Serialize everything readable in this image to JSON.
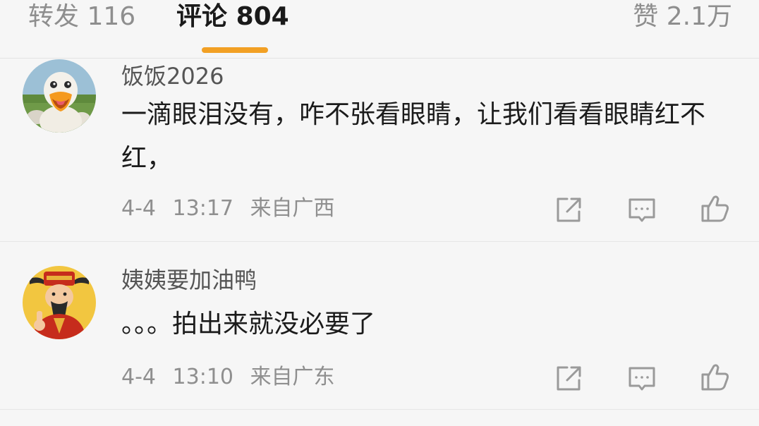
{
  "tabs": {
    "repost": {
      "label": "转发",
      "count": "116"
    },
    "comments": {
      "label": "评论",
      "count": "804"
    },
    "likes": {
      "label": "赞",
      "count": "2.1万"
    }
  },
  "comments": [
    {
      "username": "饭饭2026",
      "text": "一滴眼泪没有，咋不张看眼睛，让我们看看眼睛红不红，",
      "date": "4-4",
      "time": "13:17",
      "location": "来自广西",
      "avatar_icon": "duck-avatar-icon"
    },
    {
      "username": "姨姨要加油鸭",
      "text": "。。。拍出来就没必要了",
      "date": "4-4",
      "time": "13:10",
      "location": "来自广东",
      "avatar_icon": "fortune-god-avatar-icon"
    }
  ],
  "colors": {
    "accent_indicator": "#f2a024",
    "meta_text": "#8f8f8f",
    "icon_stroke": "#9a9a9a"
  }
}
